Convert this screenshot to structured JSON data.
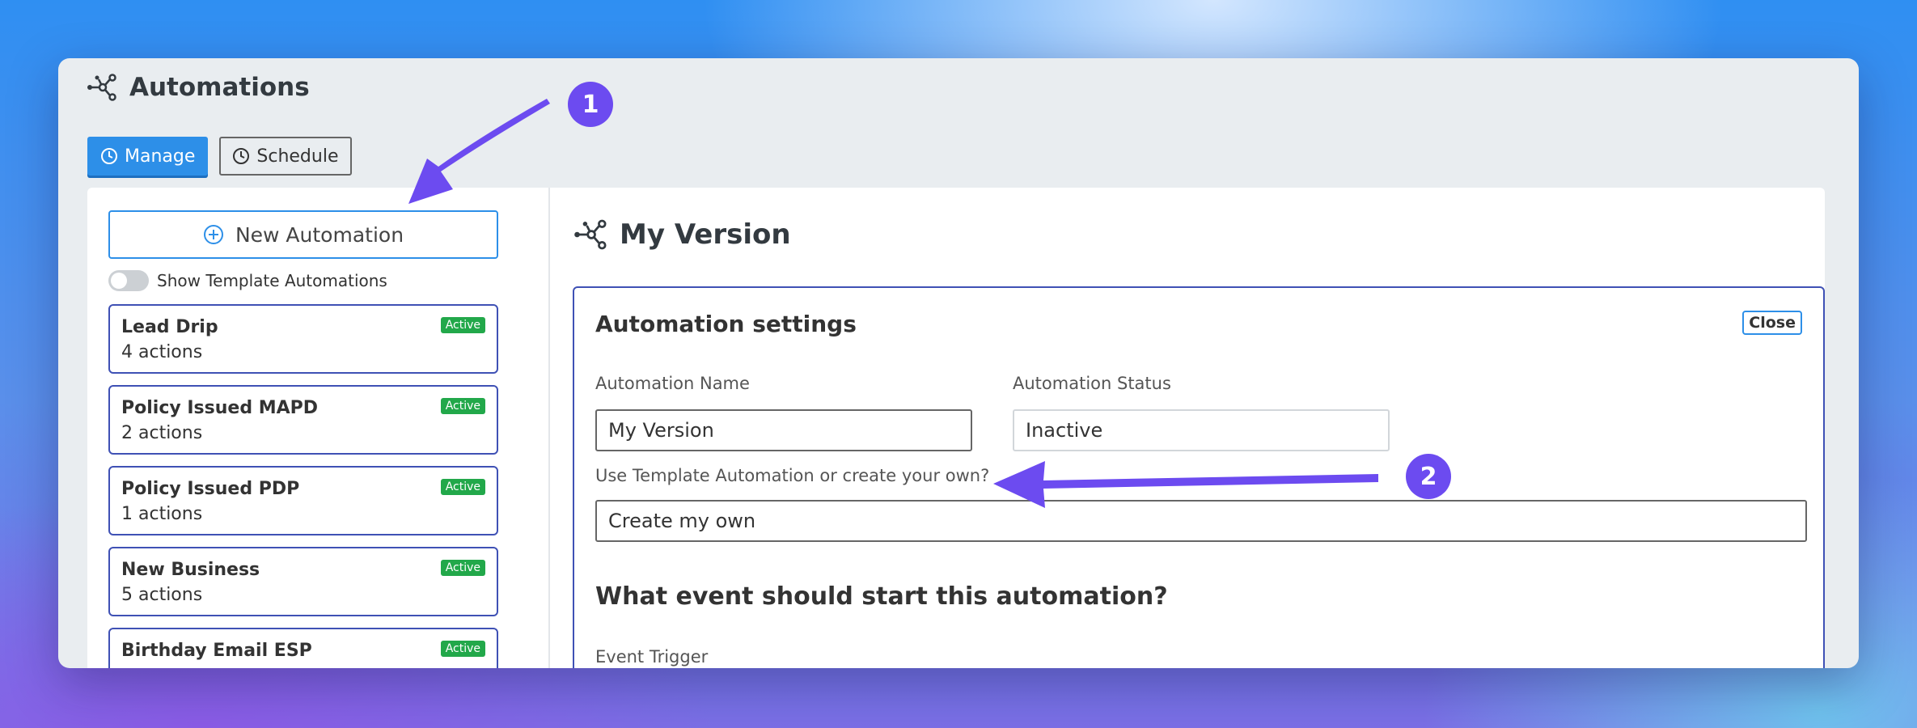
{
  "app": {
    "title": "Automations"
  },
  "tabs": [
    {
      "label": "Manage",
      "icon": "clock-icon",
      "active": true
    },
    {
      "label": "Schedule",
      "icon": "clock-icon",
      "active": false
    }
  ],
  "sidebar": {
    "new_button_label": "New Automation",
    "toggle_label": "Show Template Automations",
    "items": [
      {
        "name": "Lead Drip",
        "actions": "4 actions",
        "status": "Active"
      },
      {
        "name": "Policy Issued MAPD",
        "actions": "2 actions",
        "status": "Active"
      },
      {
        "name": "Policy Issued PDP",
        "actions": "1 actions",
        "status": "Active"
      },
      {
        "name": "New Business",
        "actions": "5 actions",
        "status": "Active"
      },
      {
        "name": "Birthday Email ESP",
        "actions": "",
        "status": "Active"
      }
    ]
  },
  "main": {
    "title": "My Version",
    "settings": {
      "title": "Automation settings",
      "close_label": "Close",
      "name_label": "Automation Name",
      "name_value": "My Version",
      "status_label": "Automation Status",
      "status_value": "Inactive",
      "template_label": "Use Template Automation or create your own?",
      "template_value": "Create my own",
      "event_section_title": "What event should start this automation?",
      "event_trigger_label": "Event Trigger"
    }
  },
  "annotations": {
    "callout_1": "1",
    "callout_2": "2"
  },
  "colors": {
    "primary": "#2d8fe8",
    "card_border": "#3f51b5",
    "badge": "#22a84a",
    "callout": "#6c4bf0"
  }
}
